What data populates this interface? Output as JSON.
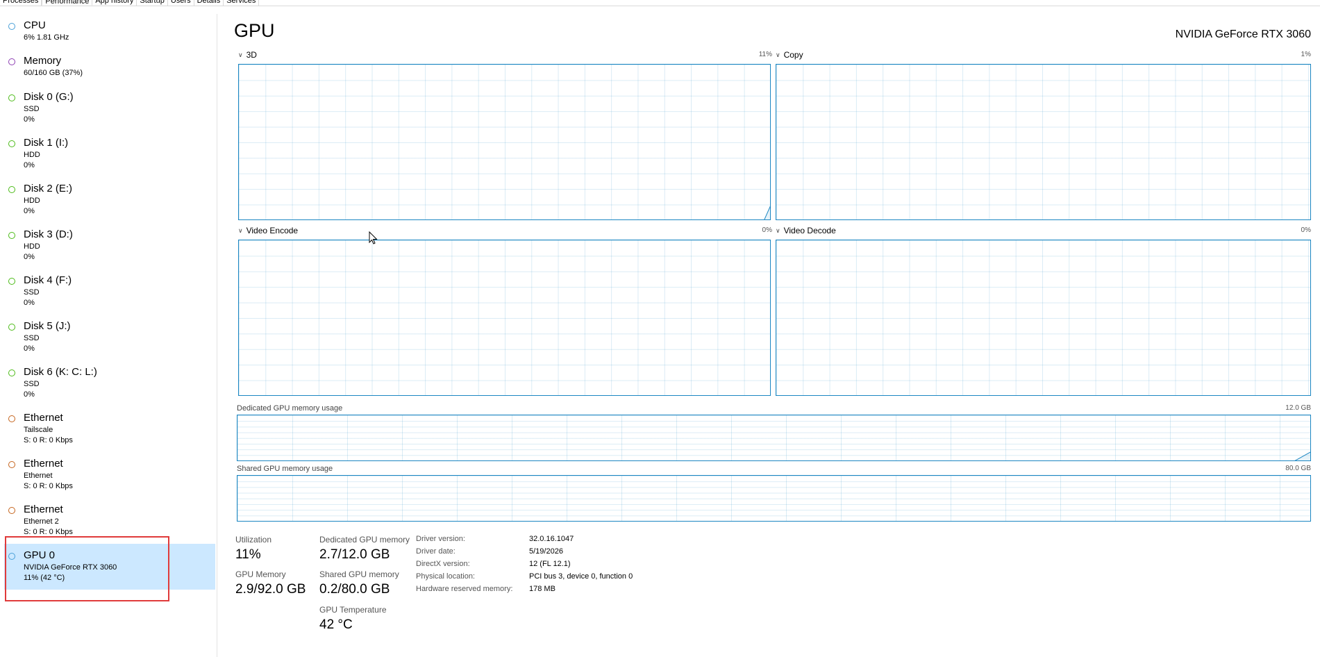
{
  "tabs": [
    "Processes",
    "Performance",
    "App history",
    "Startup",
    "Users",
    "Details",
    "Services"
  ],
  "colors": {
    "cpu": "#4aa0d8",
    "memory": "#8e3fb3",
    "disk": "#4cbb17",
    "ethernet": "#c5641d",
    "gpu": "#4aa0d8",
    "graph": "#1b86c2",
    "selection": "#cce8ff",
    "highlight": "#e03a3a"
  },
  "sidebar": [
    {
      "title": "CPU",
      "line1": "6% 1.81 GHz",
      "line2": "",
      "kind": "cpu"
    },
    {
      "title": "Memory",
      "line1": "60/160 GB (37%)",
      "line2": "",
      "kind": "memory"
    },
    {
      "title": "Disk 0 (G:)",
      "line1": "SSD",
      "line2": "0%",
      "kind": "disk"
    },
    {
      "title": "Disk 1 (I:)",
      "line1": "HDD",
      "line2": "0%",
      "kind": "disk"
    },
    {
      "title": "Disk 2 (E:)",
      "line1": "HDD",
      "line2": "0%",
      "kind": "disk"
    },
    {
      "title": "Disk 3 (D:)",
      "line1": "HDD",
      "line2": "0%",
      "kind": "disk"
    },
    {
      "title": "Disk 4 (F:)",
      "line1": "SSD",
      "line2": "0%",
      "kind": "disk"
    },
    {
      "title": "Disk 5 (J:)",
      "line1": "SSD",
      "line2": "0%",
      "kind": "disk"
    },
    {
      "title": "Disk 6 (K: C: L:)",
      "line1": "SSD",
      "line2": "0%",
      "kind": "disk"
    },
    {
      "title": "Ethernet",
      "line1": "Tailscale",
      "line2": "S: 0 R: 0 Kbps",
      "kind": "ethernet"
    },
    {
      "title": "Ethernet",
      "line1": "Ethernet",
      "line2": "S: 0 R: 0 Kbps",
      "kind": "ethernet"
    },
    {
      "title": "Ethernet",
      "line1": "Ethernet 2",
      "line2": "S: 0 R: 0 Kbps",
      "kind": "ethernet"
    },
    {
      "title": "GPU 0",
      "line1": "NVIDIA GeForce RTX 3060",
      "line2": "11% (42 °C)",
      "kind": "gpu",
      "selected": true
    }
  ],
  "main": {
    "title": "GPU",
    "gpu_name": "NVIDIA GeForce RTX 3060",
    "graphs": {
      "g3d": {
        "label": "3D",
        "pct": "11%",
        "level": 0.11
      },
      "copy": {
        "label": "Copy",
        "pct": "1%",
        "level": 0.01
      },
      "encode": {
        "label": "Video Encode",
        "pct": "0%",
        "level": 0
      },
      "decode": {
        "label": "Video Decode",
        "pct": "0%",
        "level": 0
      }
    },
    "dedicated_mem": {
      "label": "Dedicated GPU memory usage",
      "max": "12.0 GB",
      "used_gb": 2.7,
      "total_gb": 12.0
    },
    "shared_mem": {
      "label": "Shared GPU memory usage",
      "max": "80.0 GB",
      "used_gb": 0.2,
      "total_gb": 80.0
    }
  },
  "stats": {
    "utilization_label": "Utilization",
    "utilization": "11%",
    "gpu_memory_label": "GPU Memory",
    "gpu_memory": "2.9/92.0 GB",
    "dedicated_label": "Dedicated GPU memory",
    "dedicated": "2.7/12.0 GB",
    "shared_label": "Shared GPU memory",
    "shared": "0.2/80.0 GB",
    "temp_label": "GPU Temperature",
    "temp": "42 °C"
  },
  "details": [
    {
      "key": "Driver version:",
      "value": "32.0.16.1047"
    },
    {
      "key": "Driver date:",
      "value": "5/19/2026"
    },
    {
      "key": "DirectX version:",
      "value": "12 (FL 12.1)"
    },
    {
      "key": "Physical location:",
      "value": "PCI bus 3, device 0, function 0"
    },
    {
      "key": "Hardware reserved memory:",
      "value": "178 MB"
    }
  ]
}
